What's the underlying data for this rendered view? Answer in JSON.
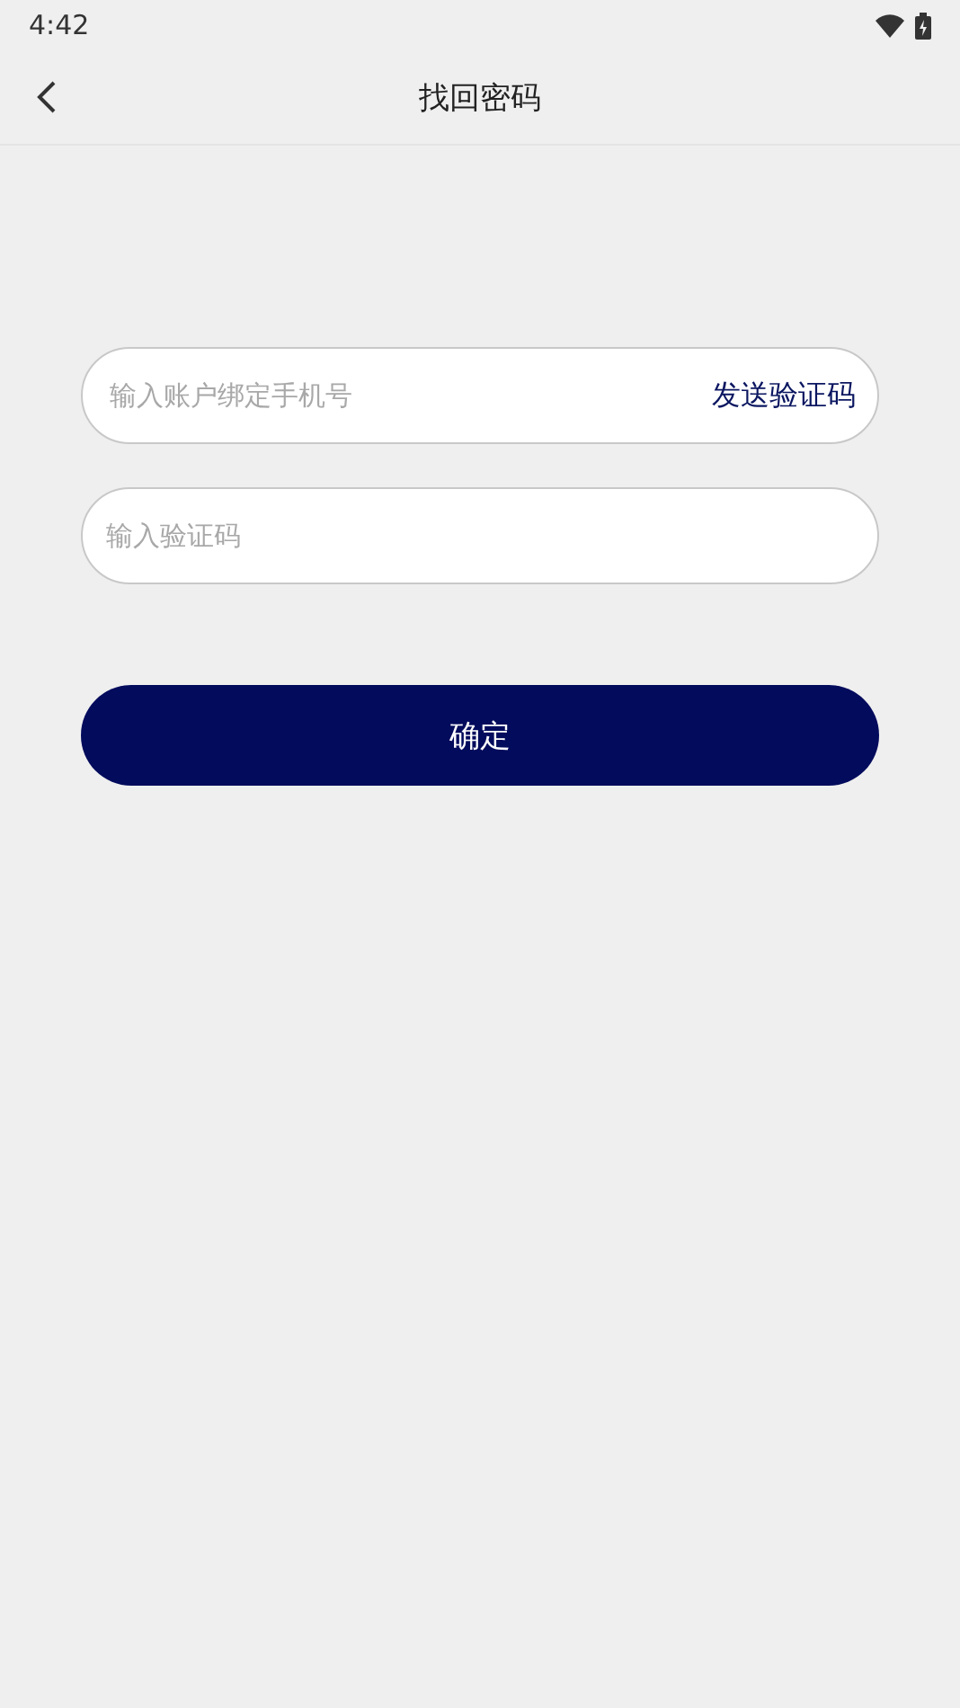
{
  "status_bar": {
    "time": "4:42"
  },
  "header": {
    "title": "找回密码"
  },
  "form": {
    "phone": {
      "placeholder": "输入账户绑定手机号"
    },
    "send_code": "发送验证码",
    "code": {
      "placeholder": "输入验证码"
    },
    "submit": "确定"
  }
}
